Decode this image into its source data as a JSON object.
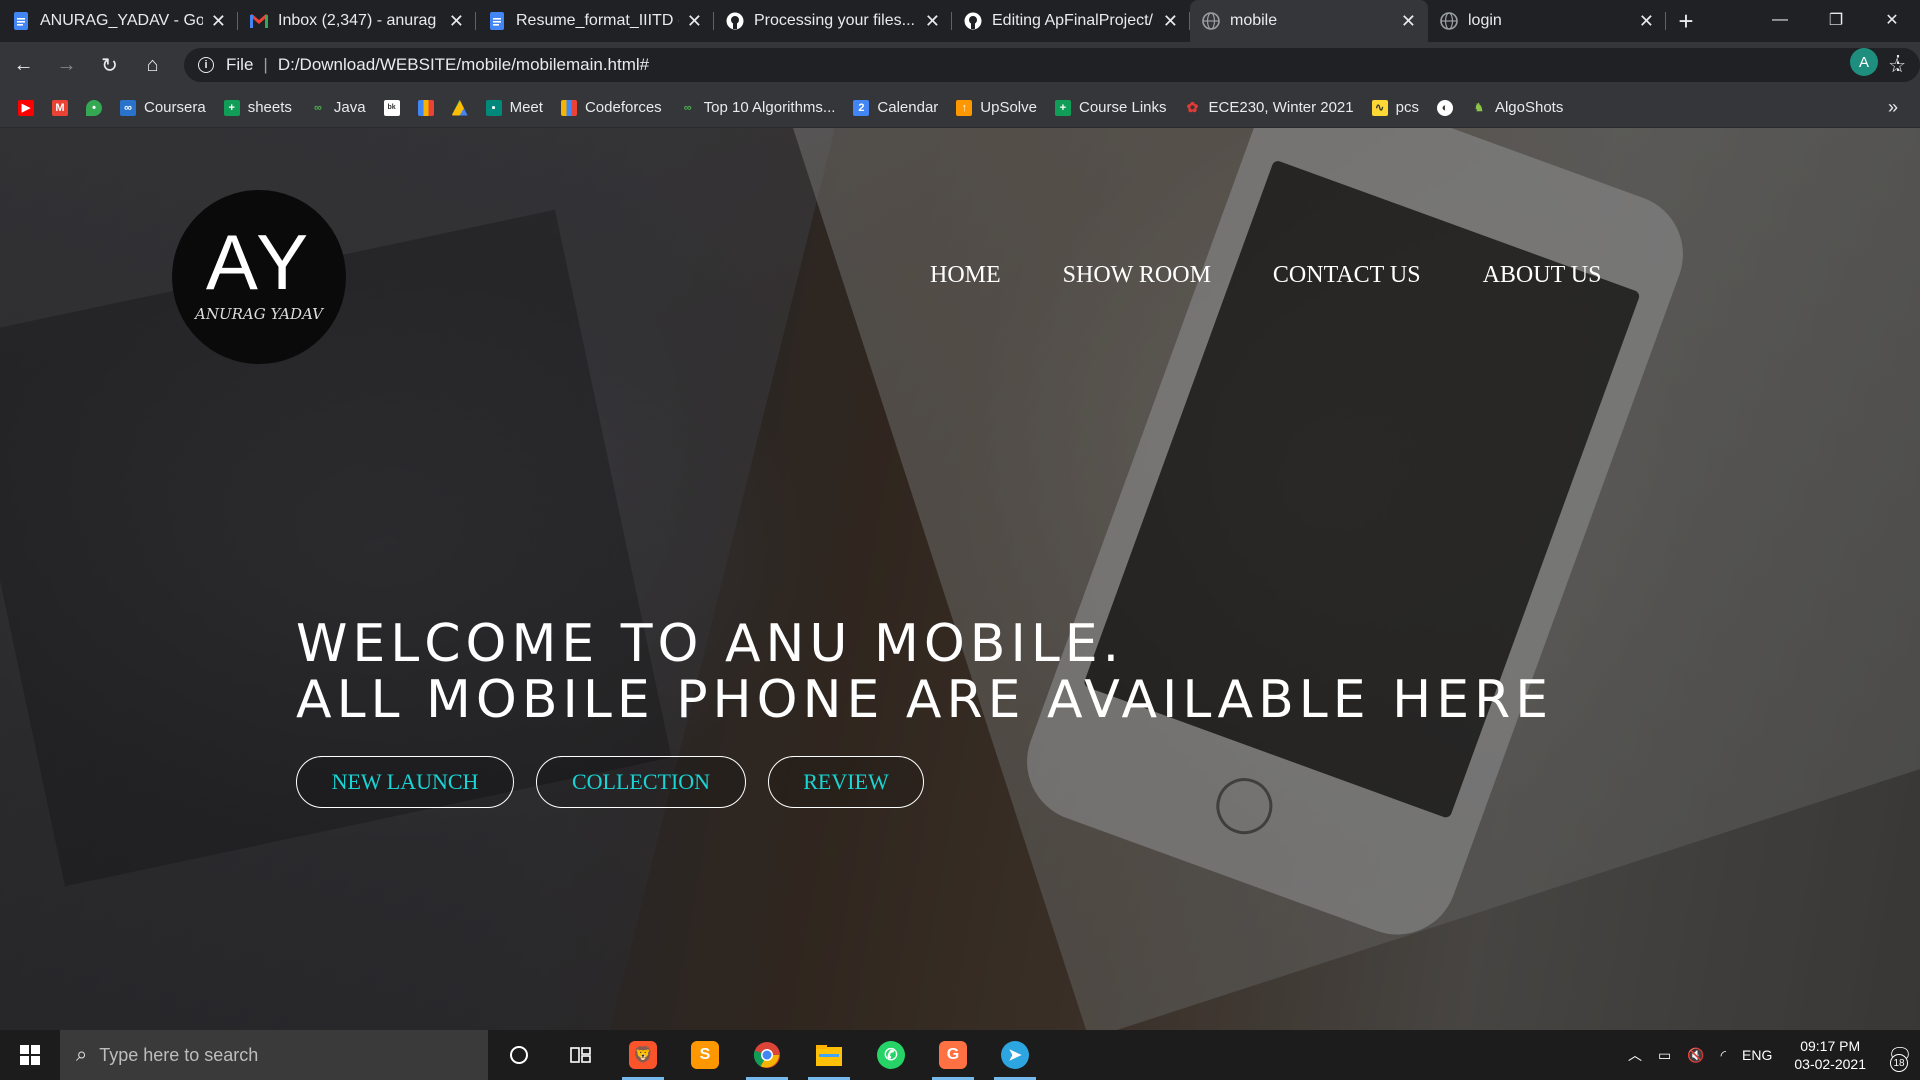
{
  "browser": {
    "tabs": [
      {
        "title": "ANURAG_YADAV - Goo",
        "icon": "google-docs-icon",
        "color": "#4285f4",
        "active": false
      },
      {
        "title": "Inbox (2,347) - anurag",
        "icon": "gmail-icon",
        "color": "#ea4335",
        "active": false
      },
      {
        "title": "Resume_format_IIITD (",
        "icon": "google-docs-icon",
        "color": "#4285f4",
        "active": false
      },
      {
        "title": "Processing your files...",
        "icon": "github-icon",
        "color": "#ffffff",
        "active": false
      },
      {
        "title": "Editing ApFinalProject/",
        "icon": "github-icon",
        "color": "#ffffff",
        "active": false
      },
      {
        "title": "mobile",
        "icon": "globe-icon",
        "color": "#9aa0a6",
        "active": true
      },
      {
        "title": "login",
        "icon": "globe-icon",
        "color": "#9aa0a6",
        "active": false
      }
    ],
    "address": {
      "scheme": "File",
      "url": "D:/Download/WEBSITE/mobile/mobilemain.html#"
    },
    "profile_initial": "A",
    "bookmarks": [
      {
        "label": "",
        "icon": "youtube-icon",
        "color": "#ff0000"
      },
      {
        "label": "",
        "icon": "gmail-icon",
        "color": "#ea4335"
      },
      {
        "label": "",
        "icon": "maps-icon",
        "color": "#34a853"
      },
      {
        "label": "Coursera",
        "icon": "coursera-icon",
        "color": "#2a73cc"
      },
      {
        "label": "sheets",
        "icon": "sheets-icon",
        "color": "#0f9d58"
      },
      {
        "label": "Java",
        "icon": "link-icon",
        "color": "#4caf50"
      },
      {
        "label": "",
        "icon": "book-icon",
        "color": "#ffffff"
      },
      {
        "label": "",
        "icon": "chart-icon",
        "color": "#f4b400"
      },
      {
        "label": "",
        "icon": "drive-icon",
        "color": "#fbbc04"
      },
      {
        "label": "Meet",
        "icon": "meet-icon",
        "color": "#00897b"
      },
      {
        "label": "Codeforces",
        "icon": "chart-icon",
        "color": "#f4b400"
      },
      {
        "label": "Top 10 Algorithms...",
        "icon": "link-icon",
        "color": "#4caf50"
      },
      {
        "label": "Calendar",
        "icon": "calendar-icon",
        "color": "#4285f4"
      },
      {
        "label": "UpSolve",
        "icon": "upsolve-icon",
        "color": "#ff9800"
      },
      {
        "label": "Course Links",
        "icon": "sheets-icon",
        "color": "#0f9d58"
      },
      {
        "label": "ECE230, Winter 2021",
        "icon": "flower-icon",
        "color": "#e53935"
      },
      {
        "label": "pcs",
        "icon": "pcs-icon",
        "color": "#fdd835"
      },
      {
        "label": "",
        "icon": "globe-icon",
        "color": "#ffffff"
      },
      {
        "label": "AlgoShots",
        "icon": "algoshots-icon",
        "color": "#8bc34a"
      }
    ]
  },
  "site": {
    "logo": {
      "monogram": "AY",
      "signature": "ANURAG YADAV"
    },
    "nav": [
      "HOME",
      "SHOW ROOM",
      "CONTACT US",
      "ABOUT US"
    ],
    "hero": {
      "line1": "Welcome to ANU mobile.",
      "line2": "All mobile phone are available here"
    },
    "buttons": [
      "NEW LAUNCH",
      "COLLECTION",
      "REVIEW"
    ],
    "accent_color": "#19d4d4"
  },
  "taskbar": {
    "search_placeholder": "Type here to search",
    "apps": [
      "cortana-icon",
      "task-view-icon",
      "brave-icon",
      "sublime-icon",
      "chrome-icon",
      "file-explorer-icon",
      "whatsapp-icon",
      "pdf-icon",
      "telegram-icon"
    ],
    "language": "ENG",
    "time": "09:17 PM",
    "date": "03-02-2021",
    "notification_count": "18"
  }
}
